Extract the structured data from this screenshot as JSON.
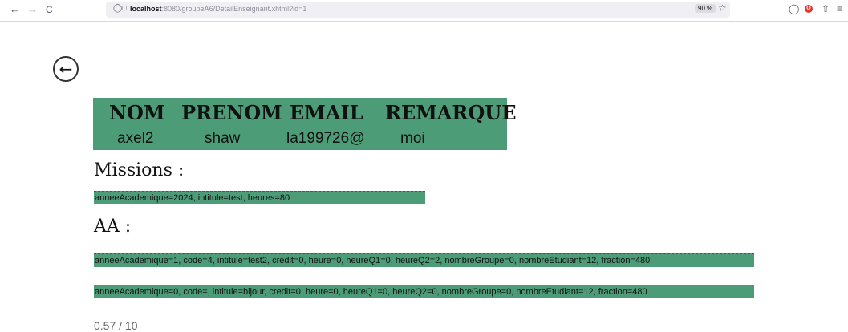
{
  "browser": {
    "url_host": "localhost",
    "url_rest": ":8080/groupeA6/DetailEnseignant.xhtml?id=1",
    "zoom": "90 %",
    "back_glyph": "←",
    "forward_glyph": "→",
    "reload_glyph": "C"
  },
  "page": {
    "back_button_glyph": "←",
    "table": {
      "headers": [
        "NOM",
        "PRENOM",
        "EMAIL",
        "REMARQUE"
      ],
      "row": [
        "axel2",
        "shaw",
        "la199726@",
        "moi"
      ]
    },
    "missions_title": "Missions :",
    "missions": [
      "anneeAcademique=2024, intitule=test, heures=80"
    ],
    "aa_title": "AA :",
    "aa": [
      "anneeAcademique=1, code=4, intitule=test2, credit=0, heure=0, heureQ1=0, heureQ2=2, nombreGroupe=0, nombreEtudiant=12, fraction=480",
      "anneeAcademique=0, code=, intitule=bijour, credit=0, heure=0, heureQ1=0, heureQ2=0, nombreGroupe=0, nombreEtudiant=12, fraction=480"
    ],
    "rating": "0.57 / 10"
  },
  "colors": {
    "row_green": "#4d9c78"
  }
}
